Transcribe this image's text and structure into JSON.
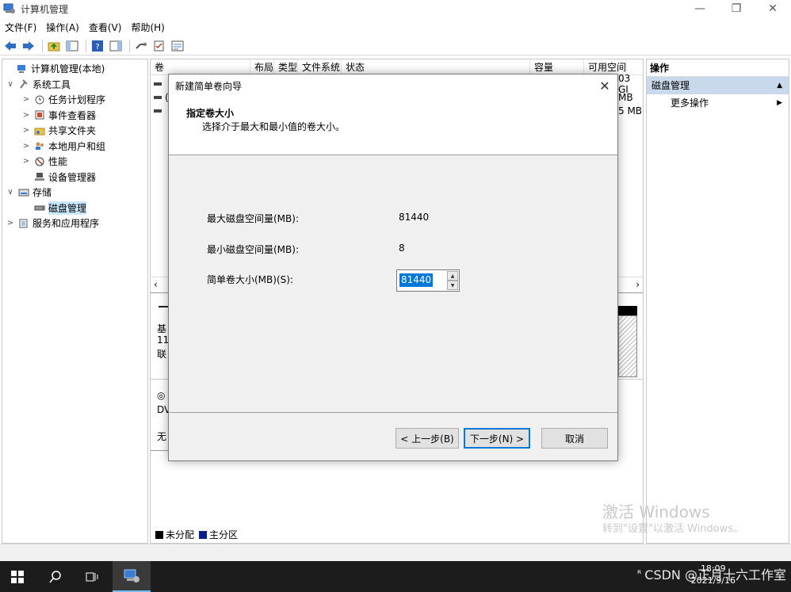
{
  "window": {
    "title": "计算机管理",
    "minimize": "—",
    "restore": "❐",
    "close": "✕"
  },
  "menubar": [
    "文件(F)",
    "操作(A)",
    "查看(V)",
    "帮助(H)"
  ],
  "tree": {
    "items": [
      {
        "label": "计算机管理(本地)",
        "exp": "",
        "indent": 0,
        "icon": "computer-management-icon"
      },
      {
        "label": "系统工具",
        "exp": "∨",
        "indent": 1,
        "icon": "system-tools-icon"
      },
      {
        "label": "任务计划程序",
        "exp": ">",
        "indent": 2,
        "icon": "task-scheduler-icon"
      },
      {
        "label": "事件查看器",
        "exp": ">",
        "indent": 2,
        "icon": "event-viewer-icon"
      },
      {
        "label": "共享文件夹",
        "exp": ">",
        "indent": 2,
        "icon": "shared-folders-icon"
      },
      {
        "label": "本地用户和组",
        "exp": ">",
        "indent": 2,
        "icon": "local-users-icon"
      },
      {
        "label": "性能",
        "exp": ">",
        "indent": 2,
        "icon": "performance-icon"
      },
      {
        "label": "设备管理器",
        "exp": "",
        "indent": 2,
        "icon": "device-manager-icon"
      },
      {
        "label": "存储",
        "exp": "∨",
        "indent": 1,
        "icon": "storage-icon"
      },
      {
        "label": "磁盘管理",
        "exp": "",
        "indent": 2,
        "icon": "disk-management-icon",
        "selected": true
      },
      {
        "label": "服务和应用程序",
        "exp": ">",
        "indent": 1,
        "icon": "services-apps-icon"
      }
    ]
  },
  "center": {
    "columns": [
      "卷",
      "布局",
      "类型",
      "文件系统",
      "状态",
      "容量",
      "可用空间"
    ],
    "right_values": [
      "03 GI",
      "MB",
      "5 MB"
    ],
    "row_fragments": [
      "(",
      ""
    ],
    "lower_fragments": [
      "基",
      "11",
      "联",
      "DV",
      "无"
    ],
    "legend": [
      {
        "label": "未分配",
        "color": "#000000"
      },
      {
        "label": "主分区",
        "color": "#0a1f8f"
      }
    ]
  },
  "actions": {
    "header": "操作",
    "section": "磁盘管理",
    "section_arrow": "▲",
    "item": "更多操作",
    "item_arrow": "▶"
  },
  "watermark": {
    "line1": "激活 Windows",
    "line2": "转到\"设置\"以激活 Windows。"
  },
  "dialog": {
    "title": "新建简单卷向导",
    "close": "✕",
    "heading": "指定卷大小",
    "subheading": "选择介于最大和最小值的卷大小。",
    "max_label": "最大磁盘空间量(MB):",
    "max_value": "81440",
    "min_label": "最小磁盘空间量(MB):",
    "min_value": "8",
    "size_label": "简单卷大小(MB)(S):",
    "size_value": "81440",
    "back_button": "< 上一步(B)",
    "next_button": "下一步(N) >",
    "cancel_button": "取消"
  },
  "taskbar": {
    "clock_time": "18:09",
    "clock_date": "2021/9/16",
    "tray_text": "CSDN @正月十六工作室"
  }
}
